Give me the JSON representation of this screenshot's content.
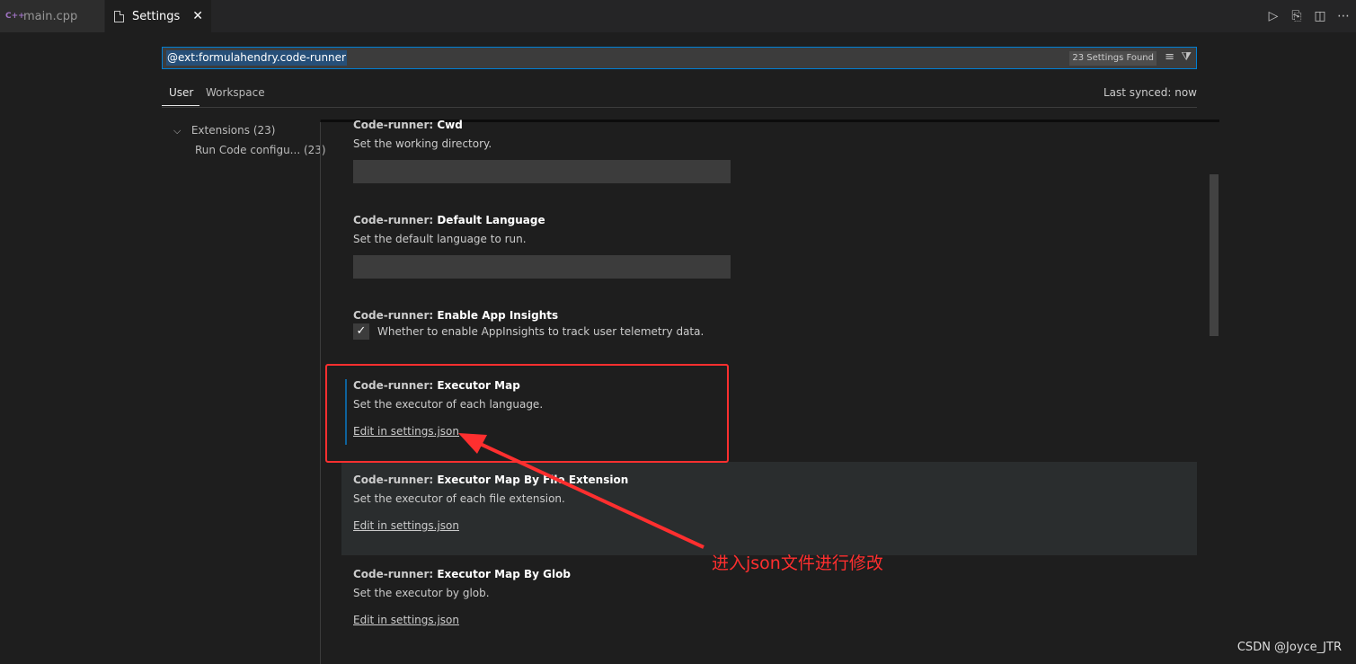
{
  "tabs": [
    {
      "label": "main.cpp",
      "icon": "cpp-file-icon",
      "icon_glyph": "C++"
    },
    {
      "label": "Settings",
      "icon": "file-icon",
      "close_glyph": "✕"
    }
  ],
  "toolbar": {
    "run": "▷",
    "open_json": "⎘",
    "split": "◫",
    "more": "⋯"
  },
  "search": {
    "value": "@ext:formulahendry.code-runner",
    "count": "23 Settings Found",
    "clear_glyph": "≡",
    "filter_glyph": "⧩"
  },
  "scopes": {
    "user": "User",
    "workspace": "Workspace",
    "last_synced": "Last synced: now"
  },
  "toc": {
    "extensions": {
      "label": "Extensions",
      "count": "(23)",
      "chevron": "⌵"
    },
    "run_code": {
      "label": "Run Code configu...",
      "count": "(23)"
    }
  },
  "settings": [
    {
      "category": "Code-runner: ",
      "name": "Cwd",
      "description": "Set the working directory."
    },
    {
      "category": "Code-runner: ",
      "name": "Default Language",
      "description": "Set the default language to run."
    },
    {
      "category": "Code-runner: ",
      "name": "Enable App Insights",
      "description": "Whether to enable AppInsights to track user telemetry data.",
      "checked_glyph": "✓"
    },
    {
      "category": "Code-runner: ",
      "name": "Executor Map",
      "description": "Set the executor of each language.",
      "link": "Edit in settings.json"
    },
    {
      "category": "Code-runner: ",
      "name": "Executor Map By File Extension",
      "description": "Set the executor of each file extension.",
      "link": "Edit in settings.json"
    },
    {
      "category": "Code-runner: ",
      "name": "Executor Map By Glob",
      "description": "Set the executor by glob.",
      "link": "Edit in settings.json"
    }
  ],
  "annotation": {
    "text": "进入json文件进行修改",
    "color": "#ff2f2f"
  },
  "watermark": "CSDN @Joyce_JTR",
  "colors": {
    "background": "#1e1e1e",
    "accent": "#007fd4",
    "selection": "#264f78"
  }
}
